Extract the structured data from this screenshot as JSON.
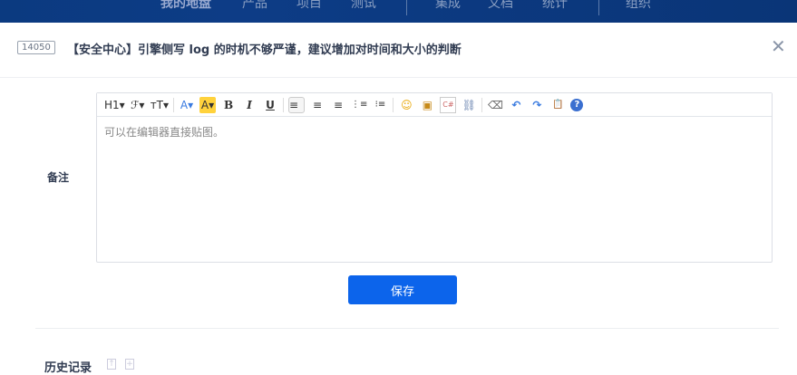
{
  "nav": {
    "items": [
      "我的地盘",
      "产品",
      "项目",
      "测试",
      "集成",
      "文档",
      "统计",
      "组织"
    ]
  },
  "modal": {
    "id": "14050",
    "title": "【安全中心】引擎侧写 log 的时机不够严谨，建议增加对时间和大小的判断",
    "close": "✕",
    "field_label": "备注",
    "editor": {
      "toolbar": [
        "H1▾",
        "ℱ▾",
        "ᴛT▾",
        "A▾",
        "A▾",
        "B",
        "I",
        "U",
        "≡",
        "≡",
        "≡",
        "⋮≡",
        "⁝≡",
        "☺",
        "▣",
        "C#",
        "⛓",
        "⌫",
        "↶",
        "↷",
        "📋",
        "?"
      ],
      "placeholder": "可以在编辑器直接贴图。"
    },
    "save_label": "保存",
    "history_label": "历史记录",
    "history_buttons": [
      "↑",
      "+"
    ]
  },
  "colors": {
    "topbar": "#0b3a80",
    "primary": "#0c64eb"
  }
}
